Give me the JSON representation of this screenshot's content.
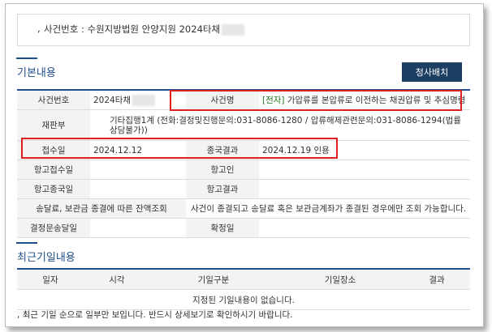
{
  "case_box": {
    "label": "사건번호 : 수원지방법원 안양지원 2024타채"
  },
  "basic_section": {
    "title": "기본내용"
  },
  "view_button": {
    "label": "청사배치"
  },
  "info": {
    "case_no_label": "사건번호",
    "case_no_value": "2024타채",
    "case_name_label": "사건명",
    "case_name_prefix": "[전자]",
    "case_name_value": " 가압류를 본압류로 이전하는 채권압류 및 추심명령",
    "court_label": "재판부",
    "court_value": "기타집행1계 (전화:결정및진행문의:031-8086-1280 / 압류해제관련문의:031-8086-1294(법률상담불가))",
    "received_label": "접수일",
    "received_value": "2024.12.12",
    "result_label": "종국결과",
    "result_value": "2024.12.19 인용",
    "appeal_received_label": "항고접수일",
    "appellant_label": "항고인",
    "appeal_end_label": "항고종국일",
    "appeal_result_label": "항고결과",
    "deposit_label": "송달료, 보관금 종결에 따른 잔액조회",
    "deposit_value": "사건이 종결되고 송달료 혹은 보관금계좌가 종결된 경우에만 조회 가능합니다.",
    "decision_delivery_label": "결정문송달일",
    "confirm_label": "확정일"
  },
  "recent_section": {
    "title": "최근기일내용"
  },
  "history": {
    "headers": [
      "일자",
      "시각",
      "기일구분",
      "기일장소",
      "결과"
    ],
    "empty_message": "지정된 기일내용이 없습니다."
  },
  "note": "최근 기일 순으로 일부만 보입니다. 반드시 상세보기로 확인하시기 바랍니다."
}
